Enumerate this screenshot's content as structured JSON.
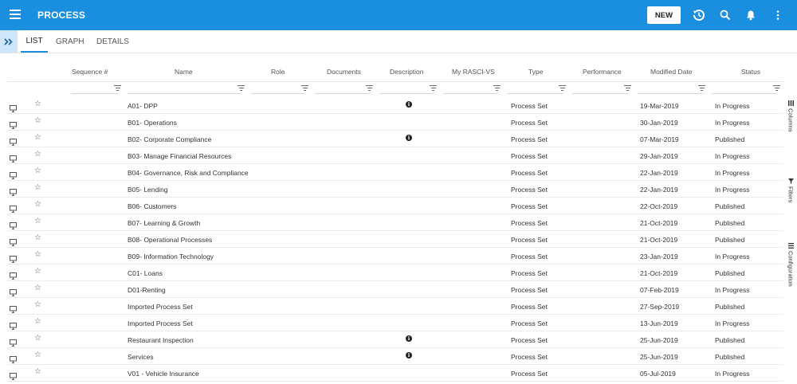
{
  "topbar": {
    "menu_icon": "hamburger-menu-icon",
    "title": "PROCESS",
    "new_button": "NEW",
    "icons": [
      "history-icon",
      "search-icon",
      "bell-icon",
      "more-vertical-icon"
    ],
    "color": "#1a8fe0"
  },
  "tabs": {
    "expander_icon": "double-chevron-right-icon",
    "items": [
      {
        "label": "LIST",
        "active": true
      },
      {
        "label": "GRAPH",
        "active": false
      },
      {
        "label": "DETAILS",
        "active": false
      }
    ]
  },
  "table": {
    "columns": [
      "Sequence #",
      "Name",
      "Role",
      "Documents",
      "Description",
      "My RASCI-VS",
      "Type",
      "Performance",
      "Modified Date",
      "Status"
    ],
    "rows": [
      {
        "name": "A01- DPP",
        "description_info": true,
        "type": "Process Set",
        "modified": "19-Mar-2019",
        "status": "In Progress"
      },
      {
        "name": "B01- Operations",
        "description_info": false,
        "type": "Process Set",
        "modified": "30-Jan-2019",
        "status": "In Progress"
      },
      {
        "name": "B02- Corporate Compliance",
        "description_info": true,
        "type": "Process Set",
        "modified": "07-Mar-2019",
        "status": "Published"
      },
      {
        "name": "B03- Manage Financial Resources",
        "description_info": false,
        "type": "Process Set",
        "modified": "29-Jan-2019",
        "status": "In Progress"
      },
      {
        "name": "B04- Governance, Risk and Compliance",
        "description_info": false,
        "type": "Process Set",
        "modified": "22-Jan-2019",
        "status": "In Progress"
      },
      {
        "name": "B05- Lending",
        "description_info": false,
        "type": "Process Set",
        "modified": "22-Jan-2019",
        "status": "In Progress"
      },
      {
        "name": "B06- Customers",
        "description_info": false,
        "type": "Process Set",
        "modified": "22-Oct-2019",
        "status": "Published"
      },
      {
        "name": "B07- Learning & Growth",
        "description_info": false,
        "type": "Process Set",
        "modified": "21-Oct-2019",
        "status": "Published"
      },
      {
        "name": "B08- Operational Processes",
        "description_info": false,
        "type": "Process Set",
        "modified": "21-Oct-2019",
        "status": "Published"
      },
      {
        "name": "B09- Information Technology",
        "description_info": false,
        "type": "Process Set",
        "modified": "23-Jan-2019",
        "status": "In Progress"
      },
      {
        "name": "C01- Loans",
        "description_info": false,
        "type": "Process Set",
        "modified": "21-Oct-2019",
        "status": "Published"
      },
      {
        "name": "D01-Renting",
        "description_info": false,
        "type": "Process Set",
        "modified": "07-Feb-2019",
        "status": "In Progress"
      },
      {
        "name": "Imported Process Set",
        "description_info": false,
        "type": "Process Set",
        "modified": "27-Sep-2019",
        "status": "Published"
      },
      {
        "name": "Imported Process Set",
        "description_info": false,
        "type": "Process Set",
        "modified": "13-Jun-2019",
        "status": "In Progress"
      },
      {
        "name": "Restaurant Inspection",
        "description_info": true,
        "type": "Process Set",
        "modified": "25-Jun-2019",
        "status": "Published"
      },
      {
        "name": "Services",
        "description_info": true,
        "type": "Process Set",
        "modified": "25-Jun-2019",
        "status": "Published"
      },
      {
        "name": "V01 - Vehicle Insurance",
        "description_info": false,
        "type": "Process Set",
        "modified": "05-Jul-2019",
        "status": "In Progress"
      }
    ]
  },
  "side_panels": [
    {
      "label": "Columns",
      "icon": "columns-icon"
    },
    {
      "label": "Filters",
      "icon": "filter-icon"
    },
    {
      "label": "Configuration",
      "icon": "configuration-icon"
    }
  ]
}
